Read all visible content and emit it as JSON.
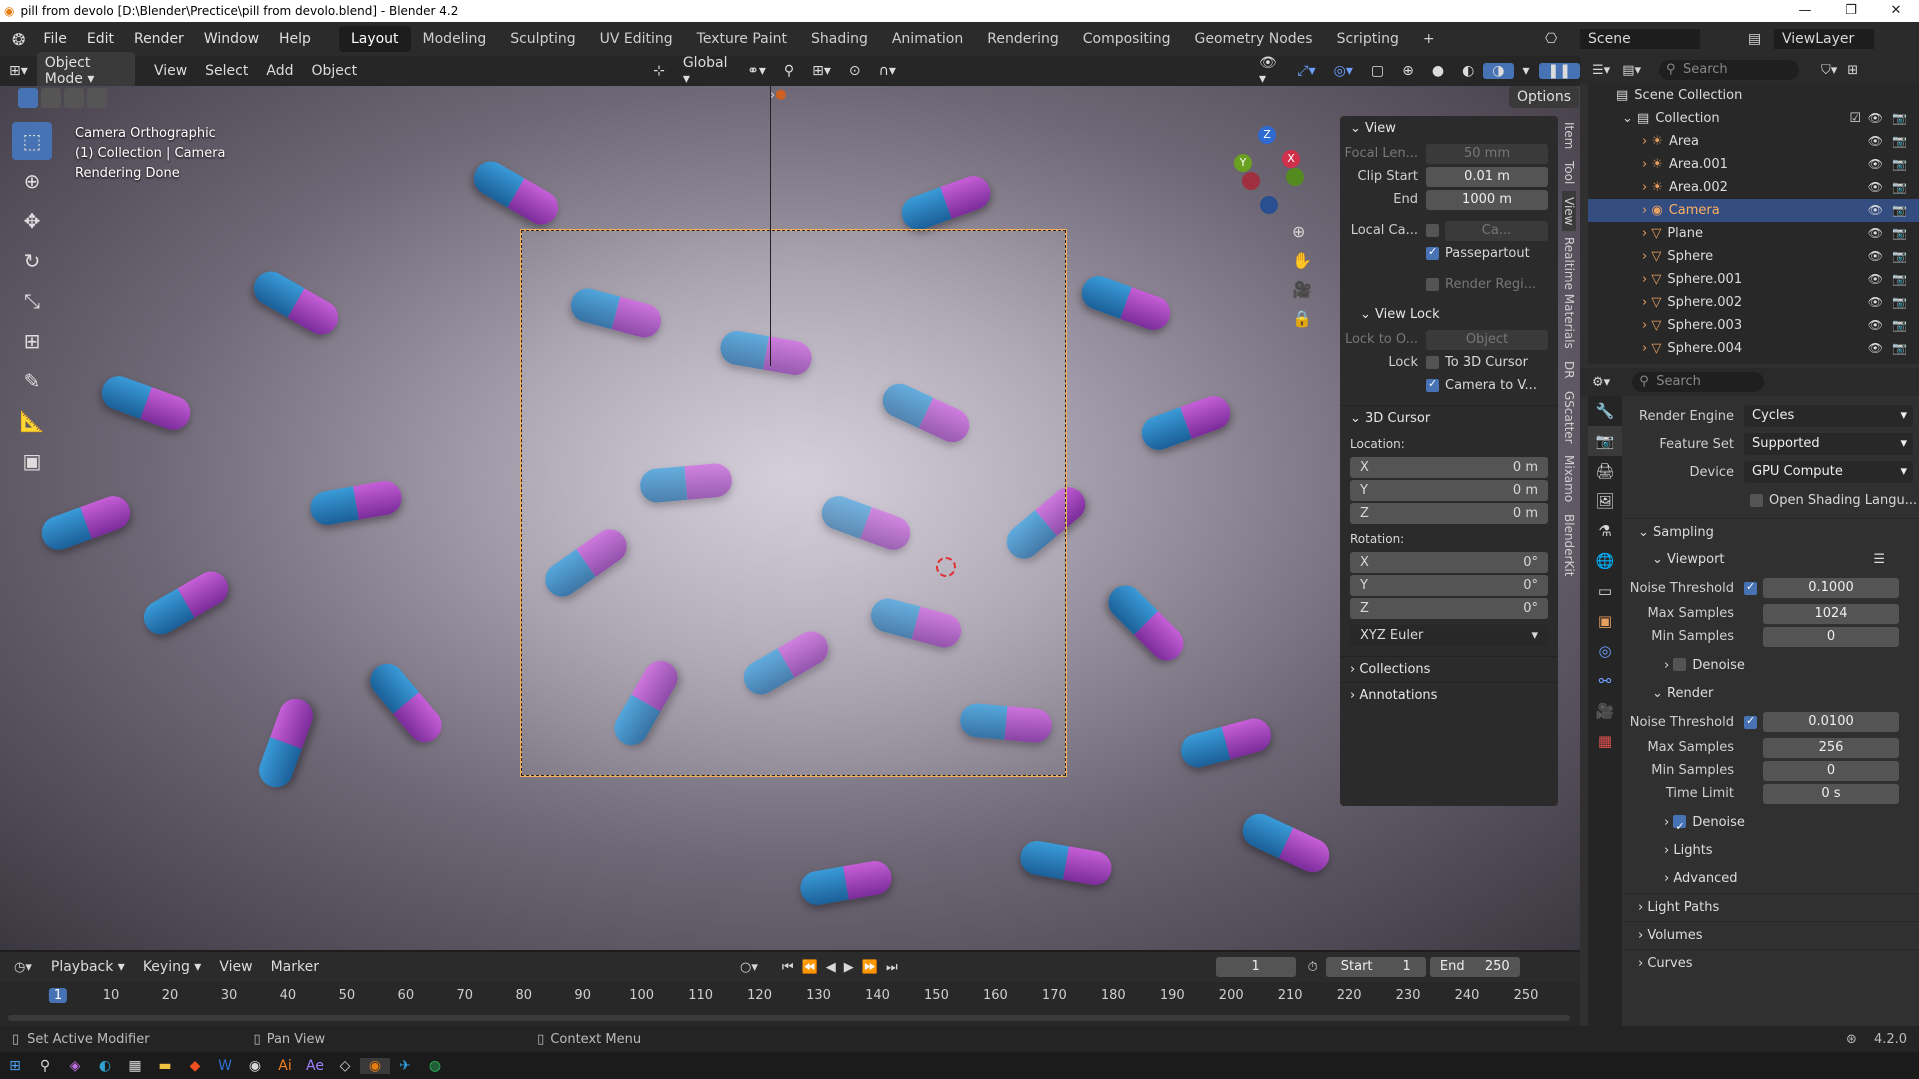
{
  "window": {
    "title": "pill from devolo [D:\\Blender\\Prectice\\pill from devolo.blend] - Blender 4.2"
  },
  "menus": [
    "File",
    "Edit",
    "Render",
    "Window",
    "Help"
  ],
  "workspaces": [
    "Layout",
    "Modeling",
    "Sculpting",
    "UV Editing",
    "Texture Paint",
    "Shading",
    "Animation",
    "Rendering",
    "Compositing",
    "Geometry Nodes",
    "Scripting"
  ],
  "active_workspace": "Layout",
  "scene": {
    "name": "Scene",
    "viewlayer": "ViewLayer"
  },
  "viewport_header": {
    "mode": "Object Mode",
    "view": "View",
    "select": "Select",
    "add": "Add",
    "object": "Object",
    "orientation": "Global",
    "options": "Options"
  },
  "viewport_info": {
    "line1": "Camera Orthographic",
    "line2": "(1) Collection | Camera",
    "line3": "Rendering Done"
  },
  "npanel": {
    "view_title": "View",
    "focal_label": "Focal Len...",
    "focal_value": "50 mm",
    "clip_start_label": "Clip Start",
    "clip_start": "0.01 m",
    "clip_end_label": "End",
    "clip_end": "1000 m",
    "local_cam_label": "Local Ca...",
    "local_cam_value": "Ca...",
    "passepartout": "Passepartout",
    "render_region": "Render Regi...",
    "view_lock_title": "View Lock",
    "lock_to_label": "Lock to O...",
    "lock_to_value": "Object",
    "lock_label": "Lock",
    "to_3d_cursor": "To 3D Cursor",
    "camera_to_view": "Camera to V...",
    "cursor_title": "3D Cursor",
    "location_label": "Location:",
    "rotation_label": "Rotation:",
    "loc": [
      {
        "axis": "X",
        "value": "0 m"
      },
      {
        "axis": "Y",
        "value": "0 m"
      },
      {
        "axis": "Z",
        "value": "0 m"
      }
    ],
    "rot": [
      {
        "axis": "X",
        "value": "0°"
      },
      {
        "axis": "Y",
        "value": "0°"
      },
      {
        "axis": "Z",
        "value": "0°"
      }
    ],
    "rot_mode": "XYZ Euler",
    "collections": "Collections",
    "annotations": "Annotations",
    "tabs": [
      "Item",
      "Tool",
      "View",
      "Realtime Materials",
      "DR",
      "GScatter",
      "Mixamo",
      "BlenderKit"
    ]
  },
  "outliner": {
    "search": "Search",
    "root": "Scene Collection",
    "collection": "Collection",
    "items": [
      "Area",
      "Area.001",
      "Area.002",
      "Camera",
      "Plane",
      "Sphere",
      "Sphere.001",
      "Sphere.002",
      "Sphere.003",
      "Sphere.004"
    ]
  },
  "properties": {
    "search": "Search",
    "section": "Scene",
    "render_engine_label": "Render Engine",
    "render_engine": "Cycles",
    "feature_set_label": "Feature Set",
    "feature_set": "Supported",
    "device_label": "Device",
    "device": "GPU Compute",
    "osl": "Open Shading Langu...",
    "sampling": "Sampling",
    "viewport": "Viewport",
    "render": "Render",
    "noise_threshold_label": "Noise Threshold",
    "vp_noise": "0.1000",
    "vp_max_label": "Max Samples",
    "vp_max": "1024",
    "vp_min_label": "Min Samples",
    "vp_min": "0",
    "denoise": "Denoise",
    "r_noise": "0.0100",
    "r_max": "256",
    "r_min": "0",
    "time_limit_label": "Time Limit",
    "time_limit": "0 s",
    "lights": "Lights",
    "advanced": "Advanced",
    "light_paths": "Light Paths",
    "volumes": "Volumes",
    "curves": "Curves"
  },
  "timeline": {
    "playback": "Playback",
    "keying": "Keying",
    "view": "View",
    "marker": "Marker",
    "current": "1",
    "start_label": "Start",
    "start": "1",
    "end_label": "End",
    "end": "250",
    "ticks": [
      "1",
      "10",
      "20",
      "30",
      "40",
      "50",
      "60",
      "70",
      "80",
      "90",
      "100",
      "110",
      "120",
      "130",
      "140",
      "150",
      "160",
      "170",
      "180",
      "190",
      "200",
      "210",
      "220",
      "230",
      "240",
      "250"
    ]
  },
  "status": {
    "left": "Set Active Modifier",
    "mid": "Pan View",
    "right": "Context Menu",
    "version": "4.2.0"
  }
}
